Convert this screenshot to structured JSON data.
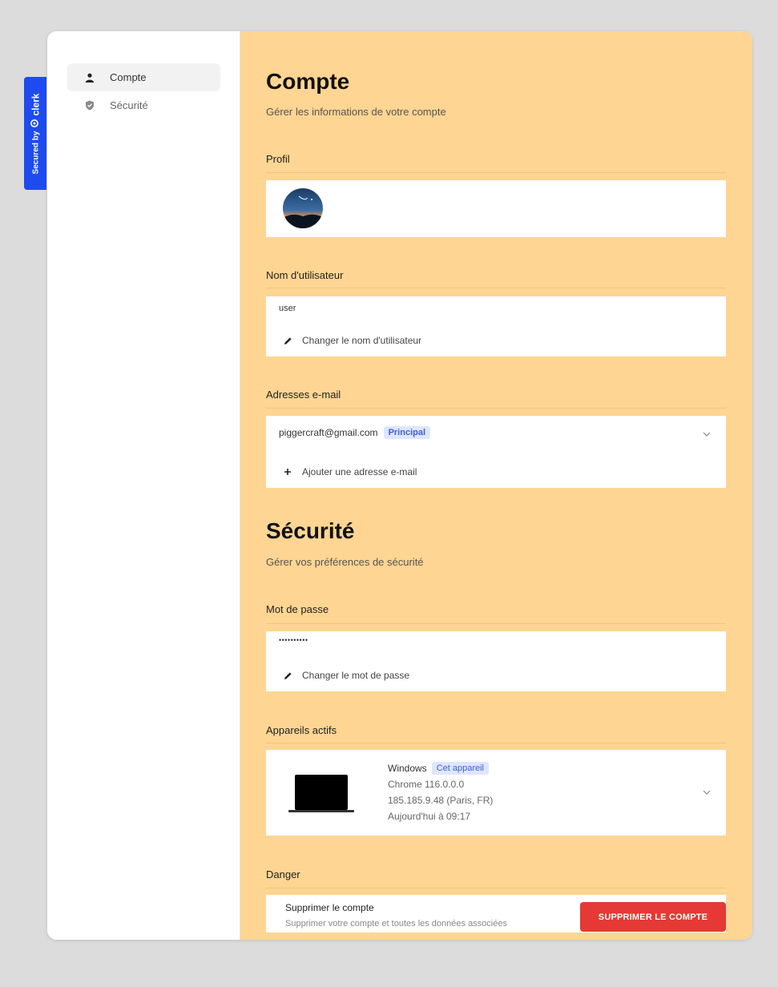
{
  "badge": {
    "prefix": "Secured by",
    "brand": "clerk"
  },
  "sidebar": {
    "items": [
      {
        "label": "Compte",
        "icon": "user-icon",
        "active": true
      },
      {
        "label": "Sécurité",
        "icon": "shield-icon",
        "active": false
      }
    ]
  },
  "account": {
    "title": "Compte",
    "subtitle": "Gérer les informations de votre compte",
    "profile": {
      "label": "Profil"
    },
    "username": {
      "label": "Nom d'utilisateur",
      "value": "user",
      "action": "Changer le nom d'utilisateur"
    },
    "emails": {
      "label": "Adresses e-mail",
      "primary_email": "piggercraft@gmail.com",
      "primary_badge": "Principal",
      "action": "Ajouter une adresse e-mail"
    }
  },
  "security": {
    "title": "Sécurité",
    "subtitle": "Gérer vos préférences de sécurité",
    "password": {
      "label": "Mot de passe",
      "value": "••••••••••",
      "action": "Changer le mot de passe"
    },
    "devices": {
      "label": "Appareils actifs",
      "items": [
        {
          "os": "Windows",
          "badge": "Cet appareil",
          "browser": "Chrome 116.0.0.0",
          "location": "185.185.9.48 (Paris, FR)",
          "last_active": "Aujourd'hui à 09:17"
        }
      ]
    },
    "danger": {
      "label": "Danger",
      "title": "Supprimer le compte",
      "description": "Supprimer votre compte et toutes les données associées",
      "button": "SUPPRIMER LE COMPTE"
    }
  },
  "colors": {
    "main_background": "#fed592",
    "danger": "#e53935",
    "badge_background": "#1e4bf0",
    "pill_background": "#dfe6ff",
    "pill_text": "#3d5fd9"
  }
}
